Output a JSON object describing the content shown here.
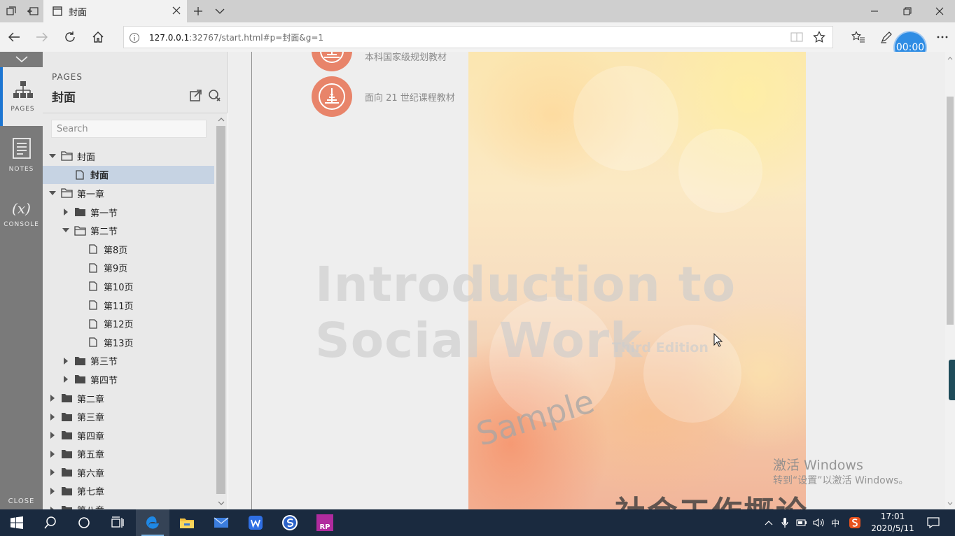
{
  "browser": {
    "tab_title": "封面",
    "url_prefix": "127.0.0.1",
    "url_rest": ":32767/start.html#p=封面&g=1",
    "timer": "00:00"
  },
  "rail": {
    "pages_label": "PAGES",
    "notes_label": "NOTES",
    "console_symbol": "(x)",
    "console_label": "CONSOLE",
    "close_label": "CLOSE"
  },
  "panel": {
    "kicker": "PAGES",
    "title": "封面",
    "search_placeholder": "Search"
  },
  "tree": [
    {
      "label": "封面",
      "level": 0,
      "kind": "folder-open",
      "toggle": "down",
      "selected": false
    },
    {
      "label": "封面",
      "level": 1,
      "kind": "page",
      "toggle": "",
      "selected": true
    },
    {
      "label": "第一章",
      "level": 0,
      "kind": "folder-open",
      "toggle": "down",
      "selected": false
    },
    {
      "label": "第一节",
      "level": 1,
      "kind": "folder-closed",
      "toggle": "right",
      "selected": false
    },
    {
      "label": "第二节",
      "level": 1,
      "kind": "folder-open",
      "toggle": "down",
      "selected": false
    },
    {
      "label": "第8页",
      "level": 2,
      "kind": "page",
      "toggle": "",
      "selected": false
    },
    {
      "label": "第9页",
      "level": 2,
      "kind": "page",
      "toggle": "",
      "selected": false
    },
    {
      "label": "第10页",
      "level": 2,
      "kind": "page",
      "toggle": "",
      "selected": false
    },
    {
      "label": "第11页",
      "level": 2,
      "kind": "page",
      "toggle": "",
      "selected": false
    },
    {
      "label": "第12页",
      "level": 2,
      "kind": "page",
      "toggle": "",
      "selected": false
    },
    {
      "label": "第13页",
      "level": 2,
      "kind": "page",
      "toggle": "",
      "selected": false
    },
    {
      "label": "第三节",
      "level": 1,
      "kind": "folder-closed",
      "toggle": "right",
      "selected": false
    },
    {
      "label": "第四节",
      "level": 1,
      "kind": "folder-closed",
      "toggle": "right",
      "selected": false
    },
    {
      "label": "第二章",
      "level": 0,
      "kind": "folder-closed",
      "toggle": "right",
      "selected": false
    },
    {
      "label": "第三章",
      "level": 0,
      "kind": "folder-closed",
      "toggle": "right",
      "selected": false
    },
    {
      "label": "第四章",
      "level": 0,
      "kind": "folder-closed",
      "toggle": "right",
      "selected": false
    },
    {
      "label": "第五章",
      "level": 0,
      "kind": "folder-closed",
      "toggle": "right",
      "selected": false
    },
    {
      "label": "第六章",
      "level": 0,
      "kind": "folder-closed",
      "toggle": "right",
      "selected": false
    },
    {
      "label": "第七章",
      "level": 0,
      "kind": "folder-closed",
      "toggle": "right",
      "selected": false
    },
    {
      "label": "第八章",
      "level": 0,
      "kind": "folder-closed",
      "toggle": "right",
      "selected": false
    }
  ],
  "cover": {
    "badge_1_text": "本科国家级规划教材",
    "badge_2_text": "面向 21 世纪课程教材",
    "en_line_1": "Introduction to",
    "en_line_2": "Social Work",
    "edition": "Third Edition",
    "sample": "Sample",
    "title_cn": "社会工作概论"
  },
  "watermark": {
    "line_1": "激活 Windows",
    "line_2": "转到“设置”以激活 Windows。"
  },
  "taskbar": {
    "ime_label": "中",
    "time": "17:01",
    "date": "2020/5/11",
    "rp_label": "RP"
  }
}
